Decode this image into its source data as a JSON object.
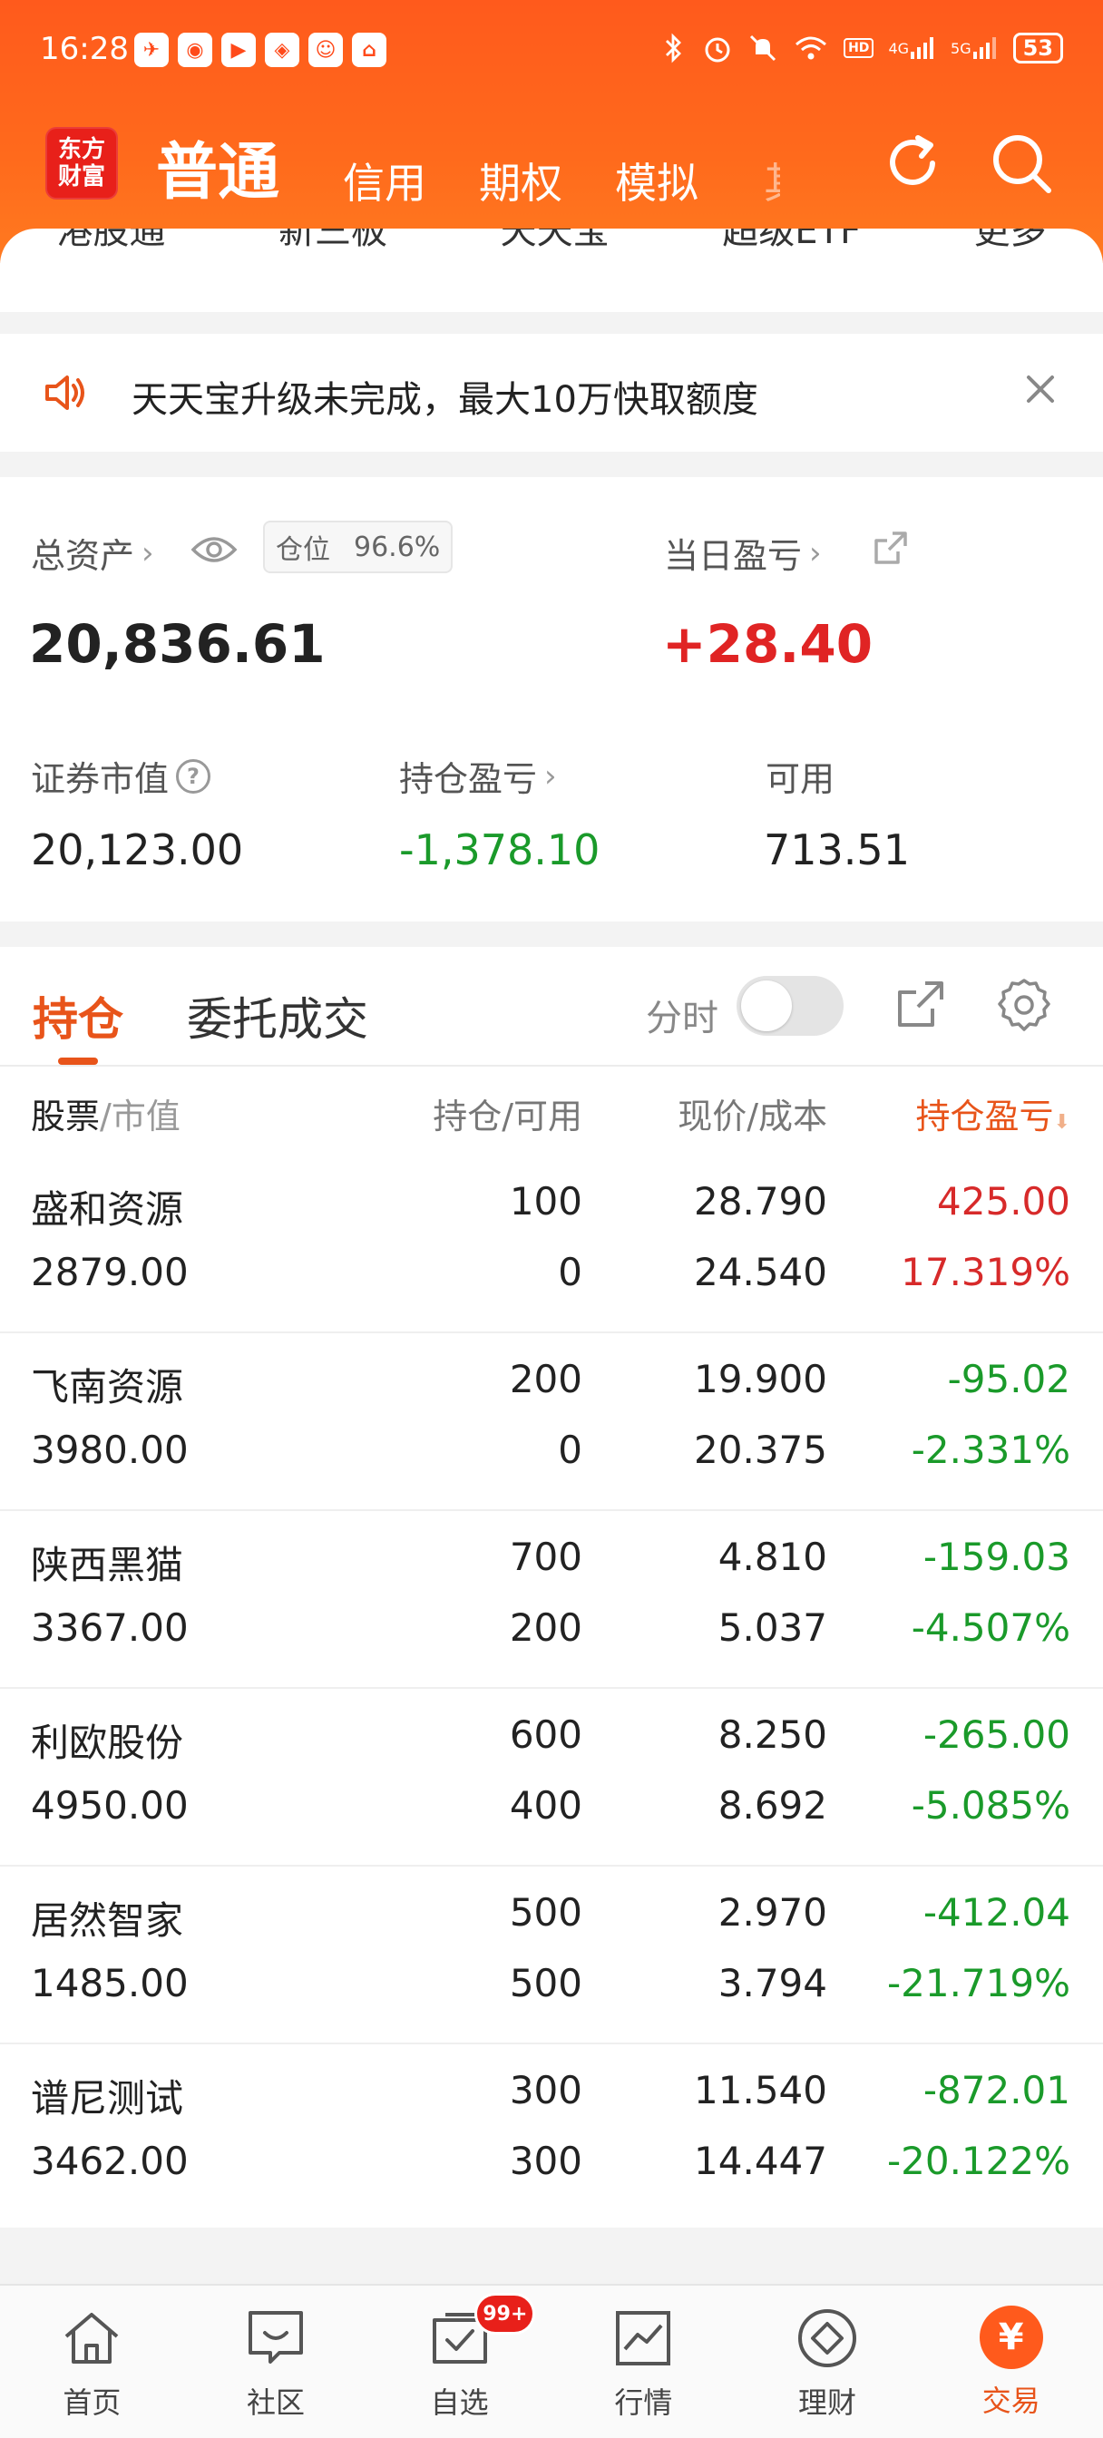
{
  "status_bar": {
    "time": "16:28",
    "network_4g": "4G",
    "network_5g": "5G",
    "hd": "HD",
    "battery": "53"
  },
  "notification_icons": [
    "wb",
    "hb",
    "xy",
    "ct",
    "nm",
    "dd"
  ],
  "app_bar": {
    "logo_line1": "东方",
    "logo_line2": "财富",
    "main_tab": "普通",
    "tabs": [
      "信用",
      "期权",
      "模拟"
    ],
    "cut_tab": "其"
  },
  "categories": [
    "港股通",
    "新三板",
    "天天宝",
    "超级ETF",
    "更多"
  ],
  "notice": {
    "text": "天天宝升级未完成，最大10万快取额度"
  },
  "asset": {
    "total_label": "总资产",
    "position_label": "仓位",
    "position_value": "96.6%",
    "total_value": "20,836.61",
    "day_pl_label": "当日盈亏",
    "day_pl_value": "+28.40",
    "market_value_label": "证券市值",
    "market_value": "20,123.00",
    "holding_pl_label": "持仓盈亏",
    "holding_pl_value": "-1,378.10",
    "available_label": "可用",
    "available_value": "713.51"
  },
  "holdings": {
    "tab_active": "持仓",
    "tab_orders": "委托成交",
    "fenshi_label": "分时",
    "header": {
      "stock": "股票",
      "market_value": "/市值",
      "qty": "持仓/可用",
      "price": "现价/成本",
      "pl": "持仓盈亏"
    },
    "rows": [
      {
        "name": "盛和资源",
        "mv": "2879.00",
        "qty": "100",
        "avail": "0",
        "price": "28.790",
        "cost": "24.540",
        "pl": "425.00",
        "pct": "17.319%",
        "dir": "up"
      },
      {
        "name": "飞南资源",
        "mv": "3980.00",
        "qty": "200",
        "avail": "0",
        "price": "19.900",
        "cost": "20.375",
        "pl": "-95.02",
        "pct": "-2.331%",
        "dir": "down"
      },
      {
        "name": "陕西黑猫",
        "mv": "3367.00",
        "qty": "700",
        "avail": "200",
        "price": "4.810",
        "cost": "5.037",
        "pl": "-159.03",
        "pct": "-4.507%",
        "dir": "down"
      },
      {
        "name": "利欧股份",
        "mv": "4950.00",
        "qty": "600",
        "avail": "400",
        "price": "8.250",
        "cost": "8.692",
        "pl": "-265.00",
        "pct": "-5.085%",
        "dir": "down"
      },
      {
        "name": "居然智家",
        "mv": "1485.00",
        "qty": "500",
        "avail": "500",
        "price": "2.970",
        "cost": "3.794",
        "pl": "-412.04",
        "pct": "-21.719%",
        "dir": "down"
      },
      {
        "name": "谱尼测试",
        "mv": "3462.00",
        "qty": "300",
        "avail": "300",
        "price": "11.540",
        "cost": "14.447",
        "pl": "-872.01",
        "pct": "-20.122%",
        "dir": "down"
      }
    ]
  },
  "bottom_nav": {
    "items": [
      "首页",
      "社区",
      "自选",
      "行情",
      "理财",
      "交易"
    ],
    "badge": "99+",
    "trade_glyph": "¥"
  },
  "colors": {
    "brand": "#ff5a1c",
    "accent": "#e8541a",
    "up": "#d72a2a",
    "down": "#1a9a2a"
  }
}
